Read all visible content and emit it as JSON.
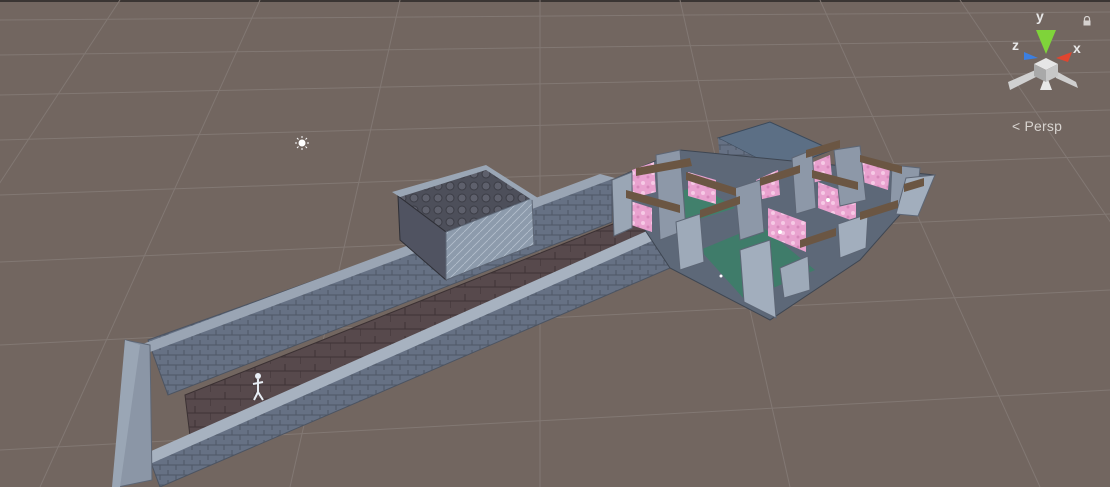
{
  "view": {
    "projection_label": "Persp",
    "projection_prefix_icon": "chevron-left-icon"
  },
  "gizmo": {
    "axis_y": "y",
    "axis_x": "x",
    "axis_z": "z",
    "colors": {
      "y": "#7fd33a",
      "x": "#e0452f",
      "z": "#3c7fe0"
    }
  },
  "colors": {
    "background": "#726660",
    "grid": "#837a74",
    "wall": "#6d7788",
    "wall_top": "#8d99a8",
    "floor_wood": "#55484a",
    "floor_stone": "#a9b4c2",
    "pink_panel": "#e8a6d0",
    "green_floor": "#3f7c6a",
    "beam": "#6b5643"
  },
  "icons": {
    "light": "sun-light-icon",
    "character": "character-icon",
    "lock": "lock-icon"
  }
}
